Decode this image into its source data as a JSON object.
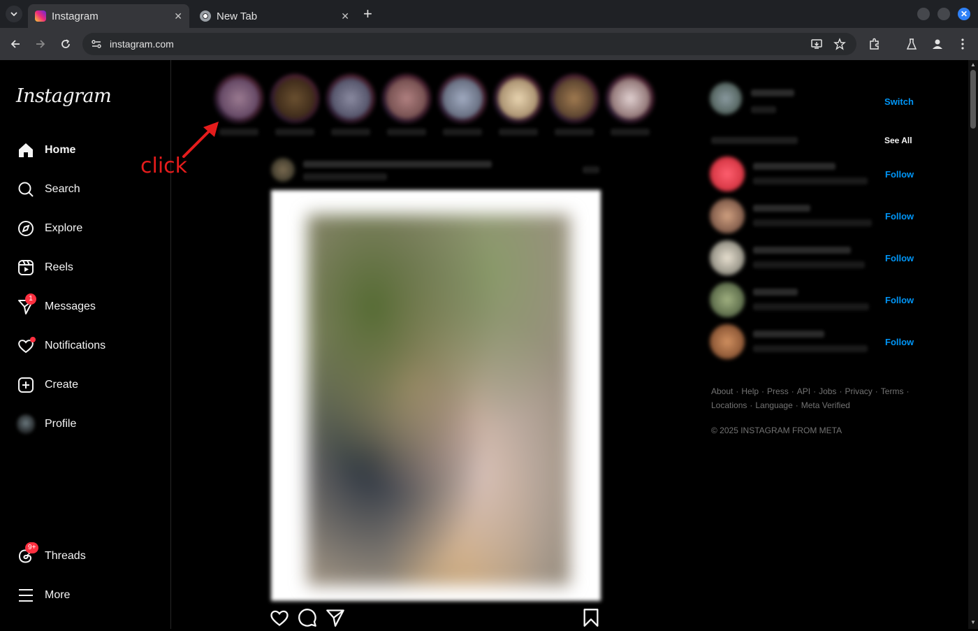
{
  "browser": {
    "tabs": [
      {
        "title": "Instagram",
        "active": true
      },
      {
        "title": "New Tab",
        "active": false
      }
    ],
    "url": "instagram.com"
  },
  "sidebar": {
    "logo": "Instagram",
    "items": [
      {
        "label": "Home",
        "icon": "home-icon"
      },
      {
        "label": "Search",
        "icon": "search-icon"
      },
      {
        "label": "Explore",
        "icon": "compass-icon"
      },
      {
        "label": "Reels",
        "icon": "reels-icon"
      },
      {
        "label": "Messages",
        "icon": "messenger-icon",
        "badge": "1"
      },
      {
        "label": "Notifications",
        "icon": "heart-icon"
      },
      {
        "label": "Create",
        "icon": "plus-square-icon"
      },
      {
        "label": "Profile",
        "icon": "avatar"
      }
    ],
    "bottom": [
      {
        "label": "Threads",
        "icon": "threads-icon",
        "badge": "9+"
      },
      {
        "label": "More",
        "icon": "hamburger-icon"
      }
    ]
  },
  "right": {
    "switch_label": "Switch",
    "see_all_label": "See All",
    "follow_label": "Follow",
    "footer_links": [
      "About",
      "Help",
      "Press",
      "API",
      "Jobs",
      "Privacy",
      "Terms",
      "Locations",
      "Language",
      "Meta Verified"
    ],
    "copyright": "© 2025 INSTAGRAM FROM META"
  },
  "annotation": {
    "text": "click",
    "color": "#e51c1c"
  },
  "colors": {
    "accent": "#0095f6",
    "badge": "#ff3040",
    "background": "#000000"
  }
}
